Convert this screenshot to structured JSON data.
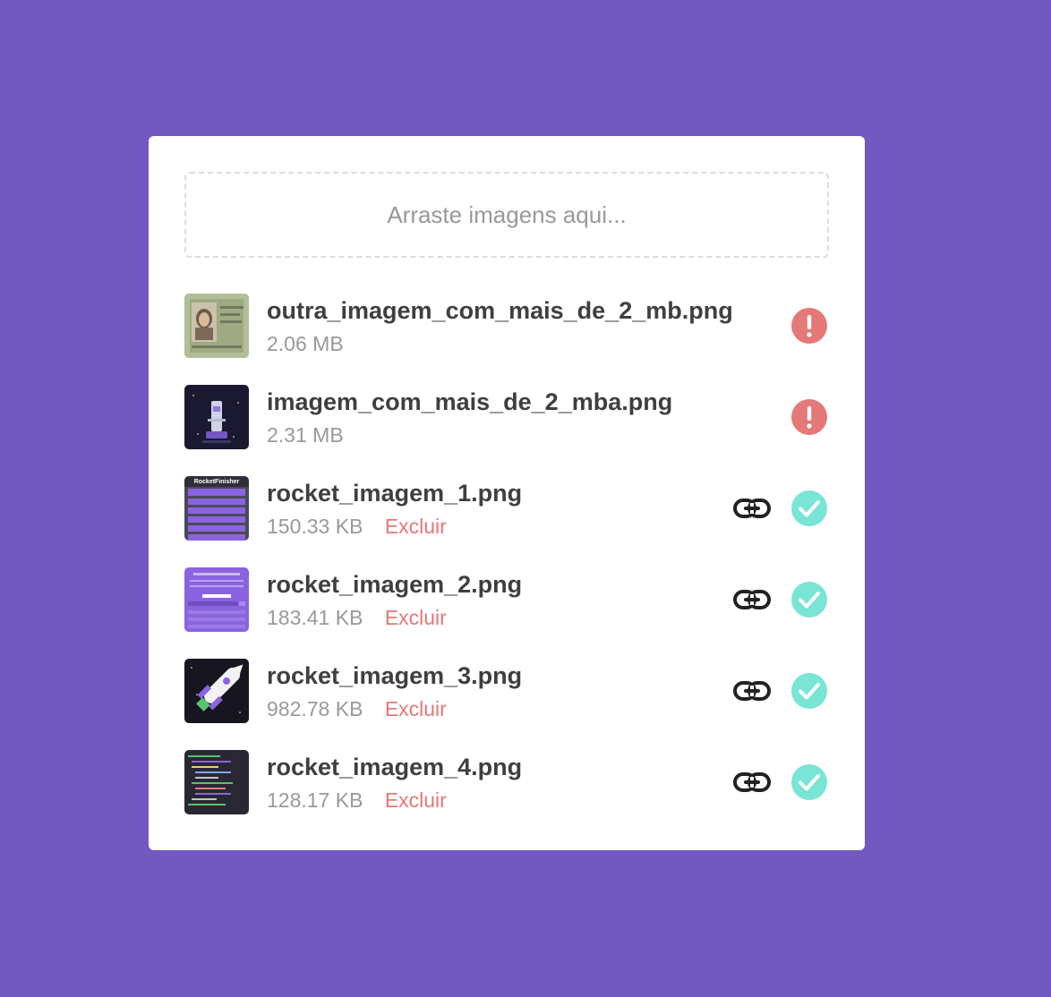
{
  "upload": {
    "placeholder": "Arraste imagens aqui..."
  },
  "colors": {
    "background": "#7159c1",
    "error": "#e57878",
    "success": "#78e5d5",
    "text": "#3f3f3f",
    "muted": "#999999"
  },
  "files": [
    {
      "name": "outra_imagem_com_mais_de_2_mb.png",
      "size": "2.06 MB",
      "status": "error",
      "thumbnail": "id-card-photo"
    },
    {
      "name": "imagem_com_mais_de_2_mba.png",
      "size": "2.31 MB",
      "status": "error",
      "thumbnail": "dark-rocket-app"
    },
    {
      "name": "rocket_imagem_1.png",
      "size": "150.33 KB",
      "status": "uploaded",
      "delete_label": "Excluir",
      "thumbnail_text": "RocketFinisher"
    },
    {
      "name": "rocket_imagem_2.png",
      "size": "183.41 KB",
      "status": "uploaded",
      "delete_label": "Excluir",
      "thumbnail": "purple-app-screen"
    },
    {
      "name": "rocket_imagem_3.png",
      "size": "982.78 KB",
      "status": "uploaded",
      "delete_label": "Excluir",
      "thumbnail": "rocket-illustration"
    },
    {
      "name": "rocket_imagem_4.png",
      "size": "128.17 KB",
      "status": "uploaded",
      "delete_label": "Excluir",
      "thumbnail": "code-editor"
    }
  ],
  "icons": {
    "error": "exclamation-circle-icon",
    "success": "check-circle-icon",
    "link": "link-icon"
  }
}
